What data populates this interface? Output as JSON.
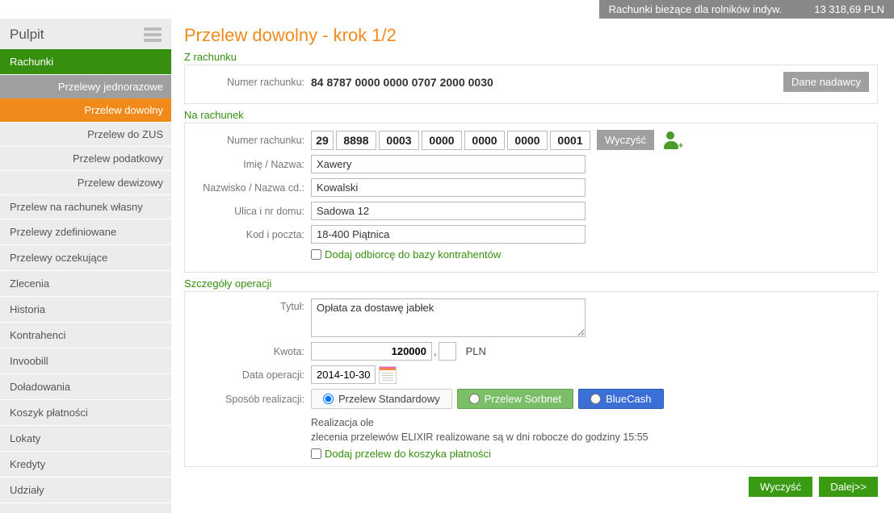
{
  "header": {
    "account_name": "Rachunki bieżące dla rolników indyw.",
    "balance": "13 318,69 PLN"
  },
  "sidebar": {
    "title": "Pulpit",
    "active_section": "Rachunki",
    "sub_header": "Przelewy jednorazowe",
    "subitems": [
      "Przelew dowolny",
      "Przelew do ZUS",
      "Przelew podatkowy",
      "Przelew dewizowy",
      "Przelew na rachunek własny"
    ],
    "items": [
      "Przelewy zdefiniowane",
      "Przelewy oczekujące",
      "Zlecenia",
      "Historia",
      "Kontrahenci",
      "Invoobill",
      "Doładowania",
      "Koszyk płatności",
      "Lokaty",
      "Kredyty",
      "Udziały"
    ]
  },
  "page": {
    "title": "Przelew dowolny - krok 1/2",
    "section_from": "Z rachunku",
    "section_to": "Na rachunek",
    "section_details": "Szczegóły operacji"
  },
  "from": {
    "label": "Numer rachunku:",
    "value": "84 8787 0000 0000 0707 2000 0030",
    "sender_btn": "Dane nadawcy"
  },
  "to": {
    "labels": {
      "nrb": "Numer rachunku:",
      "name": "Imię / Nazwa:",
      "surname": "Nazwisko / Nazwa cd.:",
      "street": "Ulica i nr domu:",
      "post": "Kod i poczta:"
    },
    "nrb": [
      "29",
      "8898",
      "0003",
      "0000",
      "0000",
      "0000",
      "0001"
    ],
    "clear_btn": "Wyczyść",
    "name": "Xawery",
    "surname": "Kowalski",
    "street": "Sadowa 12",
    "post": "18-400 Piątnica",
    "add_contact": "Dodaj odbiorcę do bazy kontrahentów"
  },
  "details": {
    "labels": {
      "title": "Tytuł:",
      "amount": "Kwota:",
      "date": "Data operacji:",
      "method": "Sposób realizacji:"
    },
    "title_value": "Opłata za dostawę jabłek",
    "amount": "120000",
    "amount_dec": "",
    "currency": "PLN",
    "date": "2014-10-30",
    "methods": {
      "standard": "Przelew Standardowy",
      "sorbnet": "Przelew Sorbnet",
      "bluecash": "BlueCash"
    },
    "hint1": "Realizacja ole",
    "hint2": "zlecenia przelewów ELIXIR realizowane są w dni robocze do godziny 15:55",
    "add_basket": "Dodaj przelew do koszyka płatności"
  },
  "footer": {
    "clear": "Wyczyść",
    "next": "Dalej>>"
  }
}
